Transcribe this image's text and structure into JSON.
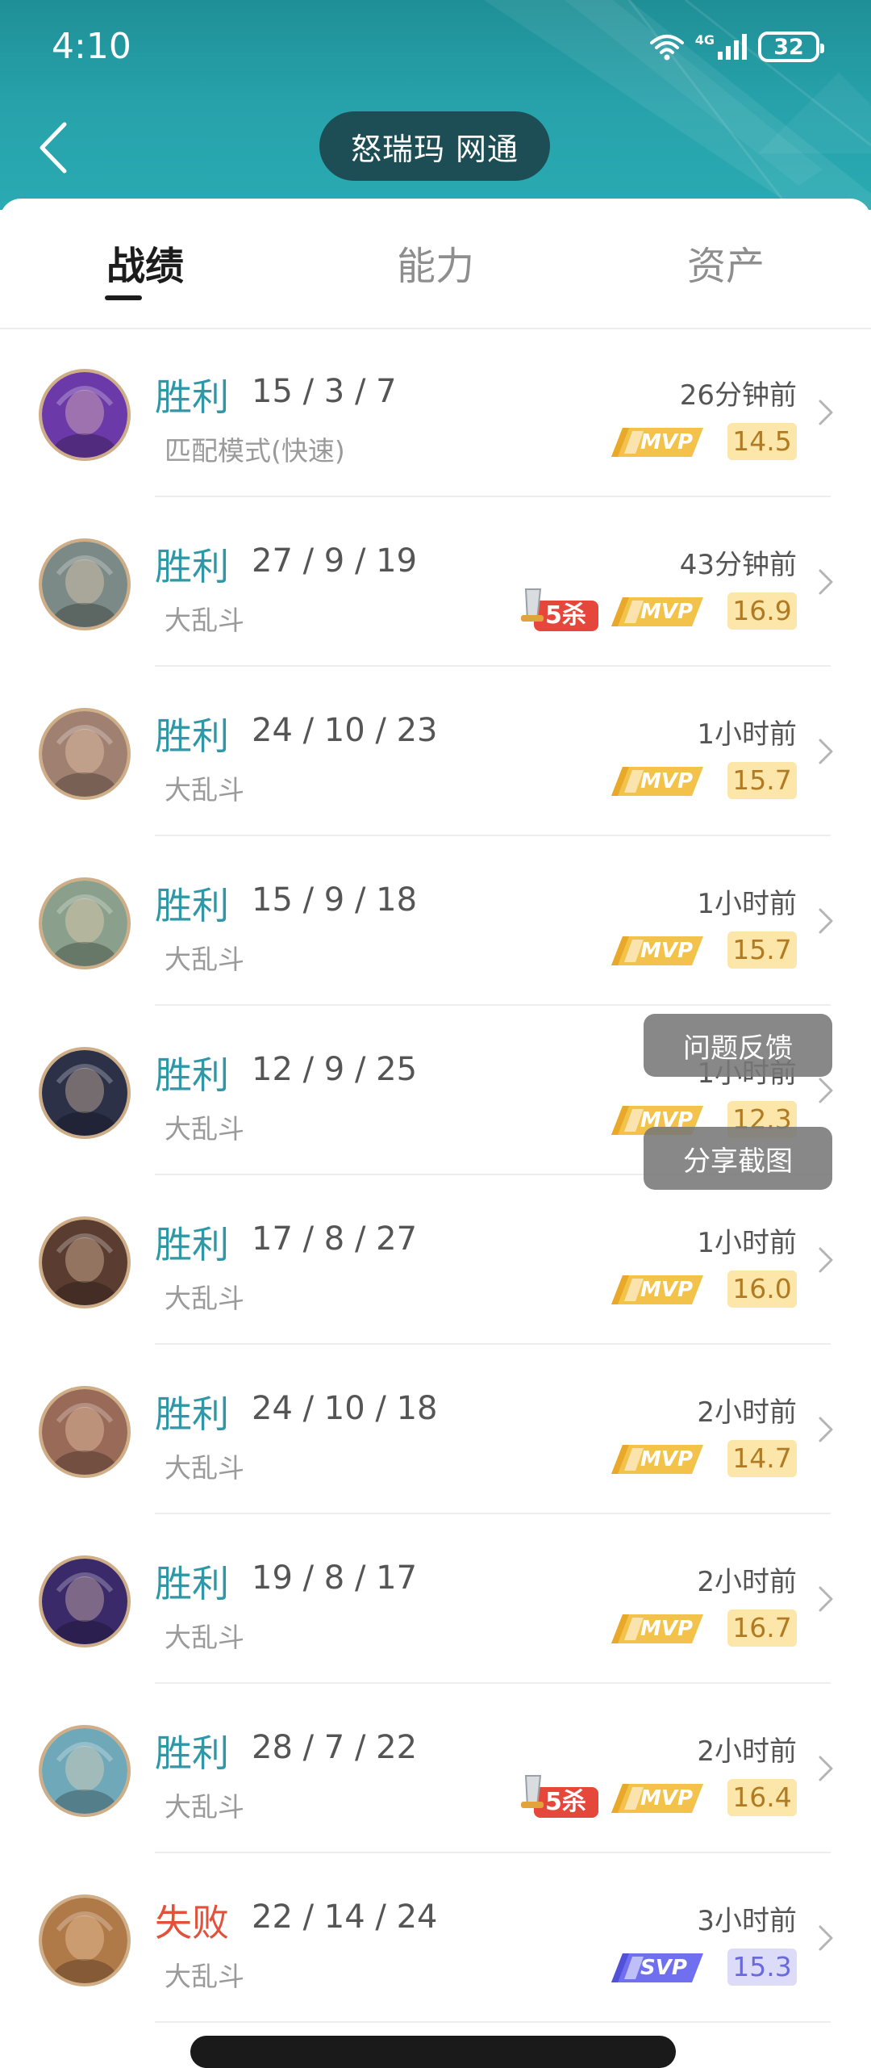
{
  "status_bar": {
    "time": "4:10",
    "network": "4G",
    "battery": "32"
  },
  "header": {
    "title": "怒瑞玛 网通"
  },
  "tabs": [
    {
      "label": "战绩",
      "active": true
    },
    {
      "label": "能力",
      "active": false
    },
    {
      "label": "资产",
      "active": false
    }
  ],
  "matches": [
    {
      "result": "胜利",
      "win": true,
      "kda": "15 / 3 / 7",
      "mode": "匹配模式(快速)",
      "time": "26分钟前",
      "badge": "MVP",
      "kills": null,
      "score": "14.5",
      "hero_color": "#6b3aa8"
    },
    {
      "result": "胜利",
      "win": true,
      "kda": "27 / 9 / 19",
      "mode": "大乱斗",
      "time": "43分钟前",
      "badge": "MVP",
      "kills": "5杀",
      "score": "16.9",
      "hero_color": "#7b8a86"
    },
    {
      "result": "胜利",
      "win": true,
      "kda": "24 / 10 / 23",
      "mode": "大乱斗",
      "time": "1小时前",
      "badge": "MVP",
      "kills": null,
      "score": "15.7",
      "hero_color": "#a08070"
    },
    {
      "result": "胜利",
      "win": true,
      "kda": "15 / 9 / 18",
      "mode": "大乱斗",
      "time": "1小时前",
      "badge": "MVP",
      "kills": null,
      "score": "15.7",
      "hero_color": "#8aa08c"
    },
    {
      "result": "胜利",
      "win": true,
      "kda": "12 / 9 / 25",
      "mode": "大乱斗",
      "time": "1小时前",
      "badge": "MVP",
      "kills": null,
      "score": "12.3",
      "hero_color": "#2c3148"
    },
    {
      "result": "胜利",
      "win": true,
      "kda": "17 / 8 / 27",
      "mode": "大乱斗",
      "time": "1小时前",
      "badge": "MVP",
      "kills": null,
      "score": "16.0",
      "hero_color": "#5a3c30"
    },
    {
      "result": "胜利",
      "win": true,
      "kda": "24 / 10 / 18",
      "mode": "大乱斗",
      "time": "2小时前",
      "badge": "MVP",
      "kills": null,
      "score": "14.7",
      "hero_color": "#9a6a58"
    },
    {
      "result": "胜利",
      "win": true,
      "kda": "19 / 8 / 17",
      "mode": "大乱斗",
      "time": "2小时前",
      "badge": "MVP",
      "kills": null,
      "score": "16.7",
      "hero_color": "#3a2a6a"
    },
    {
      "result": "胜利",
      "win": true,
      "kda": "28 / 7 / 22",
      "mode": "大乱斗",
      "time": "2小时前",
      "badge": "MVP",
      "kills": "5杀",
      "score": "16.4",
      "hero_color": "#6fa8b8"
    },
    {
      "result": "失败",
      "win": false,
      "kda": "22 / 14 / 24",
      "mode": "大乱斗",
      "time": "3小时前",
      "badge": "SVP",
      "kills": null,
      "score": "15.3",
      "hero_color": "#b07a48"
    }
  ],
  "floating_buttons": {
    "feedback": "问题反馈",
    "share": "分享截图"
  },
  "colors": {
    "win": "#2e98a6",
    "loss": "#e2513b",
    "header": "#27a2ab"
  }
}
